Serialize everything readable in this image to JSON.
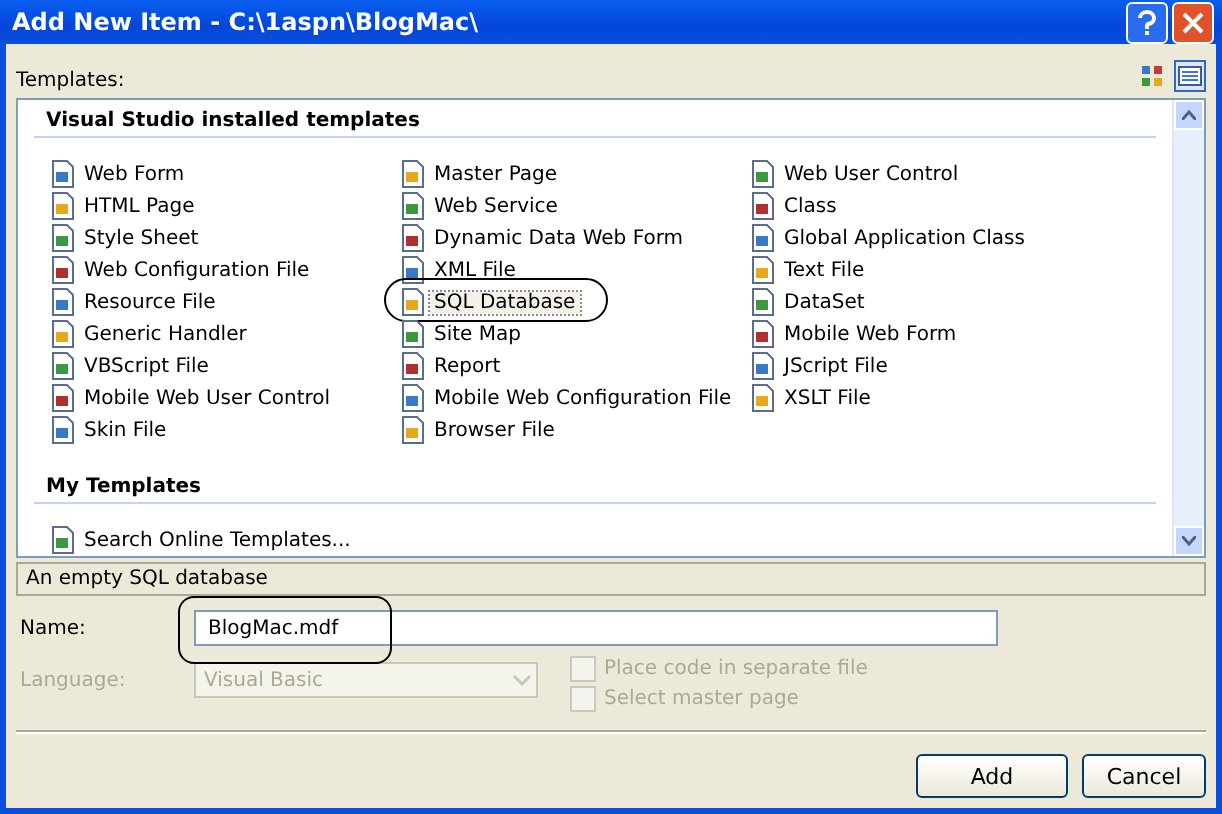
{
  "window": {
    "title": "Add New Item - C:\\1aspn\\BlogMac\\"
  },
  "view_buttons": [
    {
      "kind": "large-icons",
      "selected": false
    },
    {
      "kind": "small-icons",
      "selected": true
    }
  ],
  "templates_label": "Templates:",
  "sections": [
    {
      "title": "Visual Studio installed templates",
      "columns": [
        [
          {
            "label": "Web Form",
            "selected": false,
            "circled": false
          },
          {
            "label": "HTML Page",
            "selected": false,
            "circled": false
          },
          {
            "label": "Style Sheet",
            "selected": false,
            "circled": false
          },
          {
            "label": "Web Configuration File",
            "selected": false,
            "circled": false
          },
          {
            "label": "Resource File",
            "selected": false,
            "circled": false
          },
          {
            "label": "Generic Handler",
            "selected": false,
            "circled": false
          },
          {
            "label": "VBScript File",
            "selected": false,
            "circled": false
          },
          {
            "label": "Mobile Web User Control",
            "selected": false,
            "circled": false
          },
          {
            "label": "Skin File",
            "selected": false,
            "circled": false
          }
        ],
        [
          {
            "label": "Master Page",
            "selected": false,
            "circled": false
          },
          {
            "label": "Web Service",
            "selected": false,
            "circled": false
          },
          {
            "label": "Dynamic Data Web Form",
            "selected": false,
            "circled": false
          },
          {
            "label": "XML File",
            "selected": false,
            "circled": false
          },
          {
            "label": "SQL Database",
            "selected": true,
            "circled": true
          },
          {
            "label": "Site Map",
            "selected": false,
            "circled": false
          },
          {
            "label": "Report",
            "selected": false,
            "circled": false
          },
          {
            "label": "Mobile Web Configuration File",
            "selected": false,
            "circled": false
          },
          {
            "label": "Browser File",
            "selected": false,
            "circled": false
          }
        ],
        [
          {
            "label": "Web User Control",
            "selected": false,
            "circled": false
          },
          {
            "label": "Class",
            "selected": false,
            "circled": false
          },
          {
            "label": "Global Application Class",
            "selected": false,
            "circled": false
          },
          {
            "label": "Text File",
            "selected": false,
            "circled": false
          },
          {
            "label": "DataSet",
            "selected": false,
            "circled": false
          },
          {
            "label": "Mobile Web Form",
            "selected": false,
            "circled": false
          },
          {
            "label": "JScript File",
            "selected": false,
            "circled": false
          },
          {
            "label": "XSLT File",
            "selected": false,
            "circled": false
          }
        ]
      ]
    },
    {
      "title": "My Templates",
      "columns": [
        [
          {
            "label": "Search Online Templates...",
            "selected": false,
            "circled": false
          }
        ]
      ]
    }
  ],
  "description": "An empty SQL database",
  "name_field": {
    "label": "Name:",
    "value": "BlogMac.mdf",
    "circled": true
  },
  "language": {
    "label": "Language:",
    "value": "Visual Basic",
    "disabled": true
  },
  "checkboxes": [
    {
      "label": "Place code in separate file",
      "checked": false,
      "disabled": true
    },
    {
      "label": "Select master page",
      "checked": false,
      "disabled": true
    }
  ],
  "buttons": [
    "Add",
    "Cancel"
  ]
}
